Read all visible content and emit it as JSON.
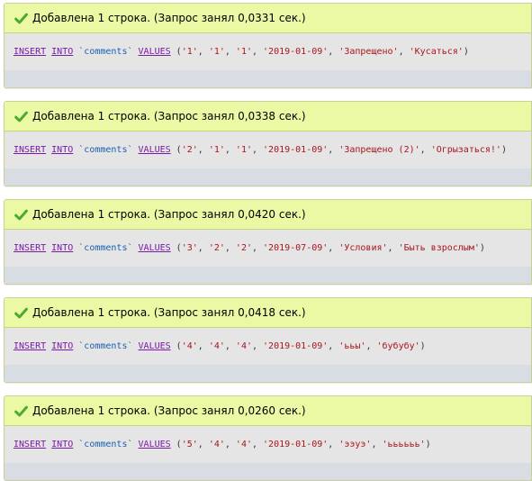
{
  "colors": {
    "success_bg": "#ebf8a4",
    "sql_bg": "#e5e5e5",
    "tools_bg": "#d8dde3",
    "keyword": "#7a1aa8",
    "identifier": "#1a5fb4",
    "string": "#a8161c",
    "check": "#4caa2c"
  },
  "icons": {
    "success": "check-icon"
  },
  "results": [
    {
      "message": "Добавлена 1 строка. (Запрос занял 0,0331 сек.)",
      "sql": {
        "insert": "INSERT",
        "into": "INTO",
        "table": "`comments`",
        "values_kw": "VALUES",
        "values": [
          "'1'",
          "'1'",
          "'1'",
          "'2019-01-09'",
          "'Запрещено'",
          "'Кусаться'"
        ]
      }
    },
    {
      "message": "Добавлена 1 строка. (Запрос занял 0,0338 сек.)",
      "sql": {
        "insert": "INSERT",
        "into": "INTO",
        "table": "`comments`",
        "values_kw": "VALUES",
        "values": [
          "'2'",
          "'1'",
          "'1'",
          "'2019-01-09'",
          "'Запрещено (2)'",
          "'Огрызаться!'"
        ]
      }
    },
    {
      "message": "Добавлена 1 строка. (Запрос занял 0,0420 сек.)",
      "sql": {
        "insert": "INSERT",
        "into": "INTO",
        "table": "`comments`",
        "values_kw": "VALUES",
        "values": [
          "'3'",
          "'2'",
          "'2'",
          "'2019-07-09'",
          "'Условия'",
          "'Быть взрослым'"
        ]
      }
    },
    {
      "message": "Добавлена 1 строка. (Запрос занял 0,0418 сек.)",
      "sql": {
        "insert": "INSERT",
        "into": "INTO",
        "table": "`comments`",
        "values_kw": "VALUES",
        "values": [
          "'4'",
          "'4'",
          "'4'",
          "'2019-01-09'",
          "'ььы'",
          "'бубубу'"
        ]
      }
    },
    {
      "message": "Добавлена 1 строка. (Запрос занял 0,0260 сек.)",
      "sql": {
        "insert": "INSERT",
        "into": "INTO",
        "table": "`comments`",
        "values_kw": "VALUES",
        "values": [
          "'5'",
          "'4'",
          "'4'",
          "'2019-01-09'",
          "'ээуэ'",
          "'ьььььь'"
        ]
      }
    }
  ]
}
